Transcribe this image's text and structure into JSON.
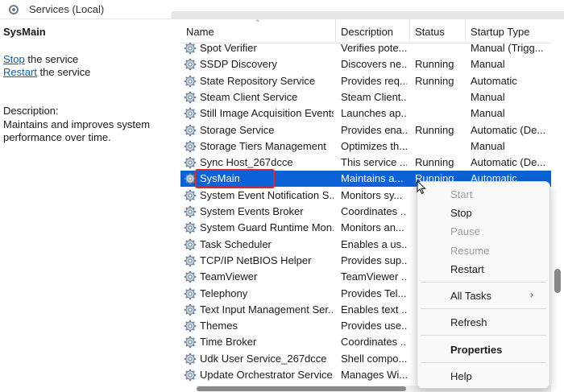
{
  "window": {
    "title": "Services (Local)"
  },
  "left_pane": {
    "service_name": "SysMain",
    "stop_link": "Stop",
    "stop_suffix": " the service",
    "restart_link": "Restart",
    "restart_suffix": " the service",
    "description_label": "Description:",
    "description_text": "Maintains and improves system performance over time."
  },
  "columns": {
    "name": "Name",
    "description": "Description",
    "status": "Status",
    "startup": "Startup Type"
  },
  "services": [
    {
      "name": "Spot Verifier",
      "description": "Verifies pote...",
      "status": "",
      "startup": "Manual (Trigg..."
    },
    {
      "name": "SSDP Discovery",
      "description": "Discovers ne...",
      "status": "Running",
      "startup": "Manual"
    },
    {
      "name": "State Repository Service",
      "description": "Provides req...",
      "status": "Running",
      "startup": "Automatic"
    },
    {
      "name": "Steam Client Service",
      "description": "Steam Client...",
      "status": "",
      "startup": "Manual"
    },
    {
      "name": "Still Image Acquisition Events",
      "description": "Launches ap...",
      "status": "",
      "startup": "Manual"
    },
    {
      "name": "Storage Service",
      "description": "Provides ena...",
      "status": "Running",
      "startup": "Automatic (De..."
    },
    {
      "name": "Storage Tiers Management",
      "description": "Optimizes th...",
      "status": "",
      "startup": "Manual"
    },
    {
      "name": "Sync Host_267dcce",
      "description": "This service ...",
      "status": "Running",
      "startup": "Automatic (De..."
    },
    {
      "name": "SysMain",
      "description": "Maintains a...",
      "status": "Running",
      "startup": "Automatic"
    },
    {
      "name": "System Event Notification S...",
      "description": "Monitors sy...",
      "status": "",
      "startup": ""
    },
    {
      "name": "System Events Broker",
      "description": "Coordinates ...",
      "status": "",
      "startup": ""
    },
    {
      "name": "System Guard Runtime Mon...",
      "description": "Monitors an...",
      "status": "",
      "startup": ""
    },
    {
      "name": "Task Scheduler",
      "description": "Enables a us...",
      "status": "",
      "startup": ""
    },
    {
      "name": "TCP/IP NetBIOS Helper",
      "description": "Provides sup...",
      "status": "",
      "startup": ""
    },
    {
      "name": "TeamViewer",
      "description": "TeamViewer ...",
      "status": "",
      "startup": ""
    },
    {
      "name": "Telephony",
      "description": "Provides Tel...",
      "status": "",
      "startup": ""
    },
    {
      "name": "Text Input Management Ser...",
      "description": "Enables text ...",
      "status": "",
      "startup": ""
    },
    {
      "name": "Themes",
      "description": "Provides use...",
      "status": "",
      "startup": ""
    },
    {
      "name": "Time Broker",
      "description": "Coordinates ...",
      "status": "",
      "startup": ""
    },
    {
      "name": "Udk User Service_267dcce",
      "description": "Shell compo...",
      "status": "",
      "startup": ""
    },
    {
      "name": "Update Orchestrator Service",
      "description": "Manages Wi...",
      "status": "",
      "startup": ""
    }
  ],
  "context_menu": {
    "start": "Start",
    "stop": "Stop",
    "pause": "Pause",
    "resume": "Resume",
    "restart": "Restart",
    "all_tasks": "All Tasks",
    "refresh": "Refresh",
    "properties": "Properties",
    "help": "Help"
  },
  "icons": {
    "service": "gear-icon",
    "submenu": "chevron-right-icon",
    "pointer": "mouse-cursor-icon"
  },
  "colors": {
    "selection": "#0b62d6",
    "highlight_box": "#e0262b",
    "link": "#0a5fb4"
  }
}
